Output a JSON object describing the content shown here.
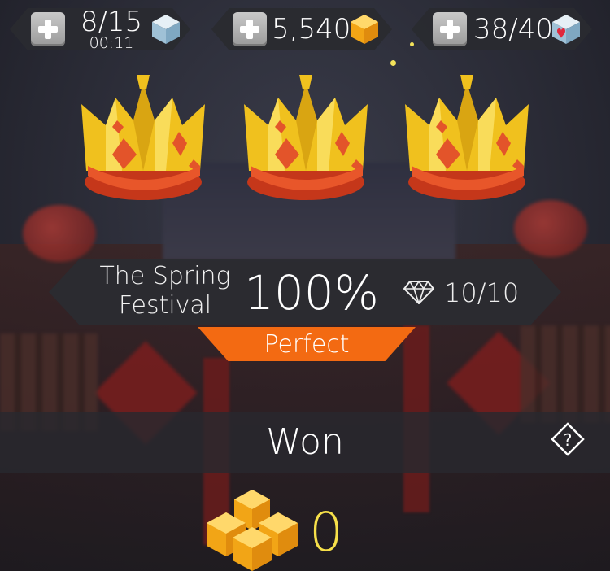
{
  "resources": {
    "energy": {
      "value": "8/15",
      "timer": "00:11",
      "icon": "blue-cube-icon"
    },
    "coins": {
      "value": "5,540",
      "icon": "gold-hexagon-icon"
    },
    "hearts": {
      "value": "38/40",
      "icon": "heart-cube-icon"
    }
  },
  "crowns": [
    "gold-crown-icon",
    "gold-crown-icon",
    "gold-crown-icon"
  ],
  "result": {
    "level_title": "The Spring\nFestival",
    "percent": "100%",
    "gems": "10/10",
    "rank": "Perfect"
  },
  "status": {
    "label": "Won"
  },
  "reward": {
    "value": "0",
    "icon": "gold-gems-pile-icon"
  },
  "colors": {
    "accent": "#f36a12",
    "gold": "#f7e04a",
    "panel": "#2b2c31"
  }
}
